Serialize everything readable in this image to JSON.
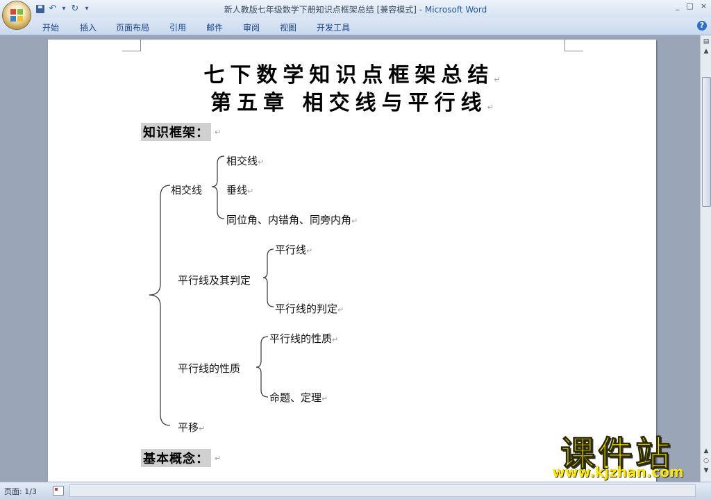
{
  "window": {
    "title": "新人教版七年级数学下册知识点框架总结 [兼容模式] - ",
    "app_name": "Microsoft Word",
    "controls": [
      "_",
      "□",
      "×"
    ]
  },
  "quick_access": {
    "save": "save-icon",
    "undo": "↶",
    "undo_arrow": "▾",
    "redo": "↻",
    "customize": "▾"
  },
  "ribbon": {
    "tabs": [
      "开始",
      "插入",
      "页面布局",
      "引用",
      "邮件",
      "审阅",
      "视图",
      "开发工具"
    ],
    "help": "?"
  },
  "document": {
    "title_line1": "七下数学知识点框架总结",
    "title_line2": "第五章  相交线与平行线",
    "paragraph_mark": "↵",
    "section1": "知识框架：",
    "section2": "基本概念：",
    "tree": {
      "root_children": [
        "相交线",
        "平行线及其判定",
        "平行线的性质",
        "平移"
      ],
      "相交线": [
        "相交线",
        "垂线",
        "同位角、内错角、同旁内角"
      ],
      "平行线及其判定": [
        "平行线",
        "平行线的判定"
      ],
      "平行线的性质": [
        "平行线的性质",
        "命题、定理"
      ]
    }
  },
  "statusbar": {
    "page": "页面: 1/3"
  },
  "watermark": {
    "main": "课件站",
    "url": "www.kjzhan.com"
  }
}
